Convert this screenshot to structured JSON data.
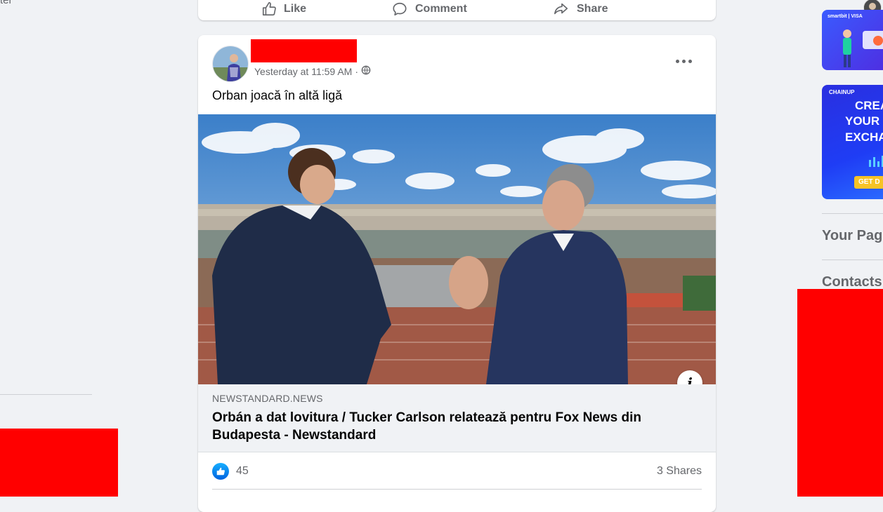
{
  "left": {
    "partial_text": "ter"
  },
  "top_card": {
    "actions": [
      {
        "label": "Like",
        "icon": "thumbs-up-icon"
      },
      {
        "label": "Comment",
        "icon": "comment-icon"
      },
      {
        "label": "Share",
        "icon": "share-icon"
      }
    ]
  },
  "post": {
    "timestamp": "Yesterday at 11:59 AM",
    "separator": "·",
    "privacy_icon": "globe-icon",
    "text": "Orban joacă în altă ligă",
    "link": {
      "domain": "NEWSTANDARD.NEWS",
      "title": "Orbán a dat lovitura / Tucker Carlson relatează pentru Fox News din Budapesta - Newstandard"
    },
    "info_label": "i",
    "reaction_count": "45",
    "shares": "3 Shares"
  },
  "right": {
    "ad1_brand": "smartbit | VISA",
    "ad2_brand": "CHAINUP",
    "ad2_lines": [
      "CREA",
      "YOUR",
      "EXCHA"
    ],
    "ad2_cta": "GET D",
    "headings": [
      "Your Pag",
      "Contacts"
    ]
  },
  "colors": {
    "accent": "#1877f2",
    "redaction": "#ff0000",
    "secondary_text": "#65676b"
  }
}
